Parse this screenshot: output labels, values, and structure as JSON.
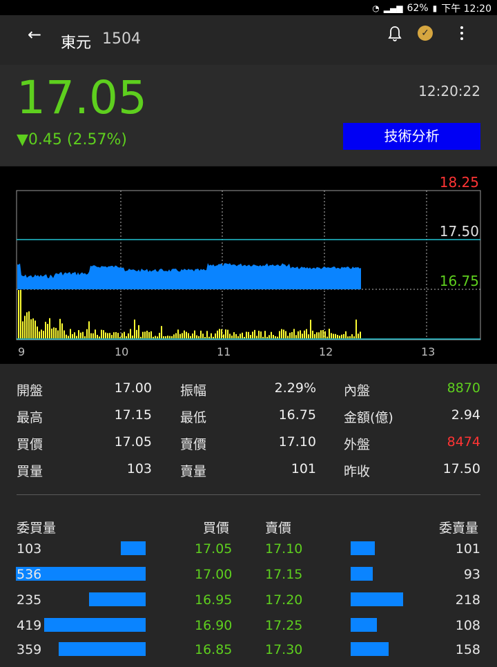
{
  "status": {
    "battery": "62%",
    "time": "下午 12:20"
  },
  "header": {
    "name": "東元",
    "code": "1504"
  },
  "quote": {
    "price": "17.05",
    "change": "▼0.45 (2.57%)",
    "time": "12:20:22",
    "ta_button": "技術分析"
  },
  "chart": {
    "y_labels": {
      "high": "18.25",
      "mid": "17.50",
      "low": "16.75"
    },
    "x_labels": [
      "9",
      "10",
      "11",
      "12",
      "13"
    ]
  },
  "stats": [
    [
      {
        "label": "開盤",
        "value": "17.00"
      },
      {
        "label": "振幅",
        "value": "2.29%"
      },
      {
        "label": "內盤",
        "value": "8870"
      }
    ],
    [
      {
        "label": "最高",
        "value": "17.15"
      },
      {
        "label": "最低",
        "value": "16.75"
      },
      {
        "label": "金額(億)",
        "value": "2.94"
      }
    ],
    [
      {
        "label": "買價",
        "value": "17.05"
      },
      {
        "label": "賣價",
        "value": "17.10"
      },
      {
        "label": "外盤",
        "value": "8474"
      }
    ],
    [
      {
        "label": "買量",
        "value": "103"
      },
      {
        "label": "賣量",
        "value": "101"
      },
      {
        "label": "昨收",
        "value": "17.50"
      }
    ]
  ],
  "orderbook": {
    "headers": {
      "bid_qty": "委買量",
      "bid": "買價",
      "ask": "賣價",
      "ask_qty": "委賣量"
    },
    "rows": [
      {
        "bid_qty": "103",
        "bid": "17.05",
        "ask": "17.10",
        "ask_qty": "101"
      },
      {
        "bid_qty": "536",
        "bid": "17.00",
        "ask": "17.15",
        "ask_qty": "93"
      },
      {
        "bid_qty": "235",
        "bid": "16.95",
        "ask": "17.20",
        "ask_qty": "218"
      },
      {
        "bid_qty": "419",
        "bid": "16.90",
        "ask": "17.25",
        "ask_qty": "108"
      },
      {
        "bid_qty": "359",
        "bid": "16.85",
        "ask": "17.30",
        "ask_qty": "158"
      }
    ]
  },
  "colors": {
    "up": "#ff3434",
    "down": "#5ecf1e",
    "button": "#0000f4",
    "bar": "#0a84ff",
    "volume": "#ffff33"
  }
}
